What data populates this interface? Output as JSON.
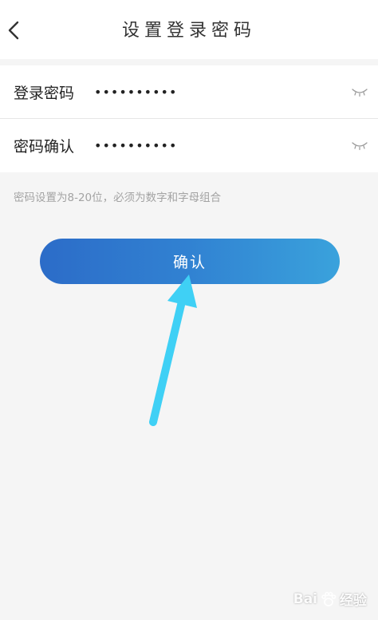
{
  "header": {
    "title": "设置登录密码",
    "back_icon": "chevron-left-icon"
  },
  "form": {
    "password": {
      "label": "登录密码",
      "value": "••••••••••",
      "eye_icon": "eye-closed-icon"
    },
    "confirm": {
      "label": "密码确认",
      "value": "••••••••••",
      "eye_icon": "eye-closed-icon"
    }
  },
  "hint": "密码设置为8-20位，必须为数字和字母组合",
  "confirm_button": {
    "label": "确认",
    "gradient_start": "#2c6cc8",
    "gradient_end": "#3aa2dc"
  },
  "annotation": {
    "arrow_color": "#3fd0f5"
  },
  "watermark": {
    "text_left": "Bai",
    "text_right": "经验"
  }
}
